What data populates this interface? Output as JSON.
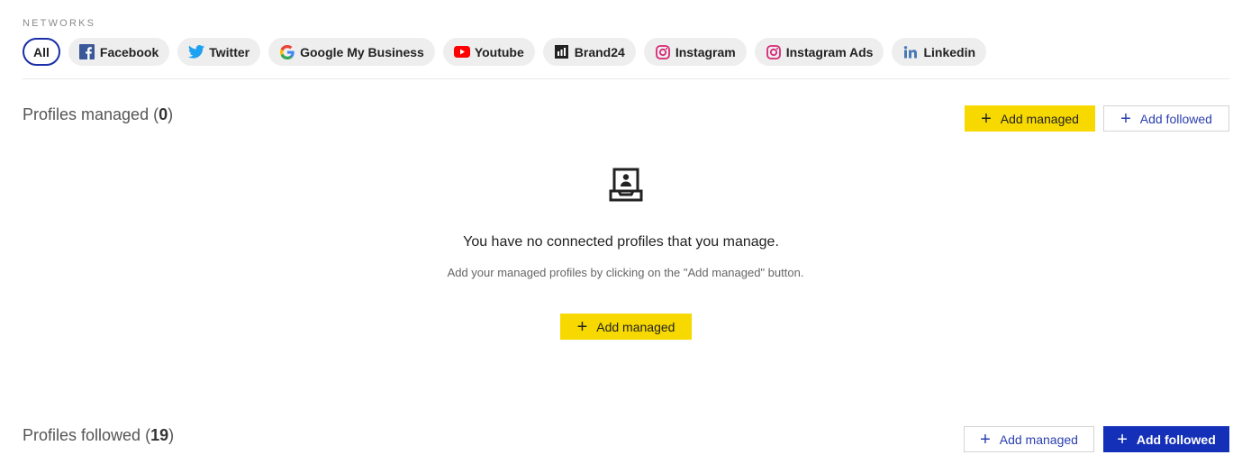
{
  "networks": {
    "label": "NETWORKS",
    "chips": [
      {
        "label": "All",
        "icon": "",
        "active": true
      },
      {
        "label": "Facebook",
        "icon": "facebook-icon"
      },
      {
        "label": "Twitter",
        "icon": "twitter-icon"
      },
      {
        "label": "Google My Business",
        "icon": "google-icon"
      },
      {
        "label": "Youtube",
        "icon": "youtube-icon"
      },
      {
        "label": "Brand24",
        "icon": "brand24-icon"
      },
      {
        "label": "Instagram",
        "icon": "instagram-icon"
      },
      {
        "label": "Instagram Ads",
        "icon": "instagram-icon"
      },
      {
        "label": "Linkedin",
        "icon": "linkedin-icon"
      }
    ]
  },
  "managed": {
    "title_prefix": "Profiles managed (",
    "count": "0",
    "title_suffix": ")",
    "add_managed_label": "Add managed",
    "add_followed_label": "Add followed",
    "empty_title": "You have no connected profiles that you manage.",
    "empty_subtitle": "Add your managed profiles by clicking on the \"Add managed\" button.",
    "empty_button_label": "Add managed"
  },
  "followed": {
    "title_prefix": "Profiles followed (",
    "count": "19",
    "title_suffix": ")",
    "add_managed_label": "Add managed",
    "add_followed_label": "Add followed"
  },
  "colors": {
    "accent_blue": "#1530b8",
    "accent_yellow": "#f7d900"
  }
}
